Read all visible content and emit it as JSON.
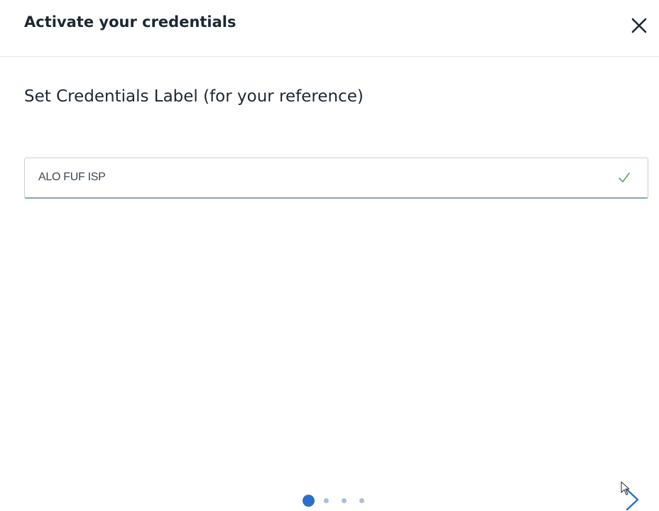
{
  "dialog": {
    "title": "Activate your credentials",
    "close_icon": "close-icon"
  },
  "form": {
    "section_label": "Set Credentials Label (for your reference)",
    "credentials_label_value": "ALO FUF ISP",
    "valid_icon": "checkmark-icon"
  },
  "pager": {
    "total_steps": 4,
    "current_step": 1
  },
  "navigation": {
    "next_icon": "chevron-right-icon"
  },
  "colors": {
    "accent": "#2b6fc9",
    "inactive_dot": "#aac0dc",
    "valid_check": "#5aa36a",
    "text": "#1d2733"
  }
}
